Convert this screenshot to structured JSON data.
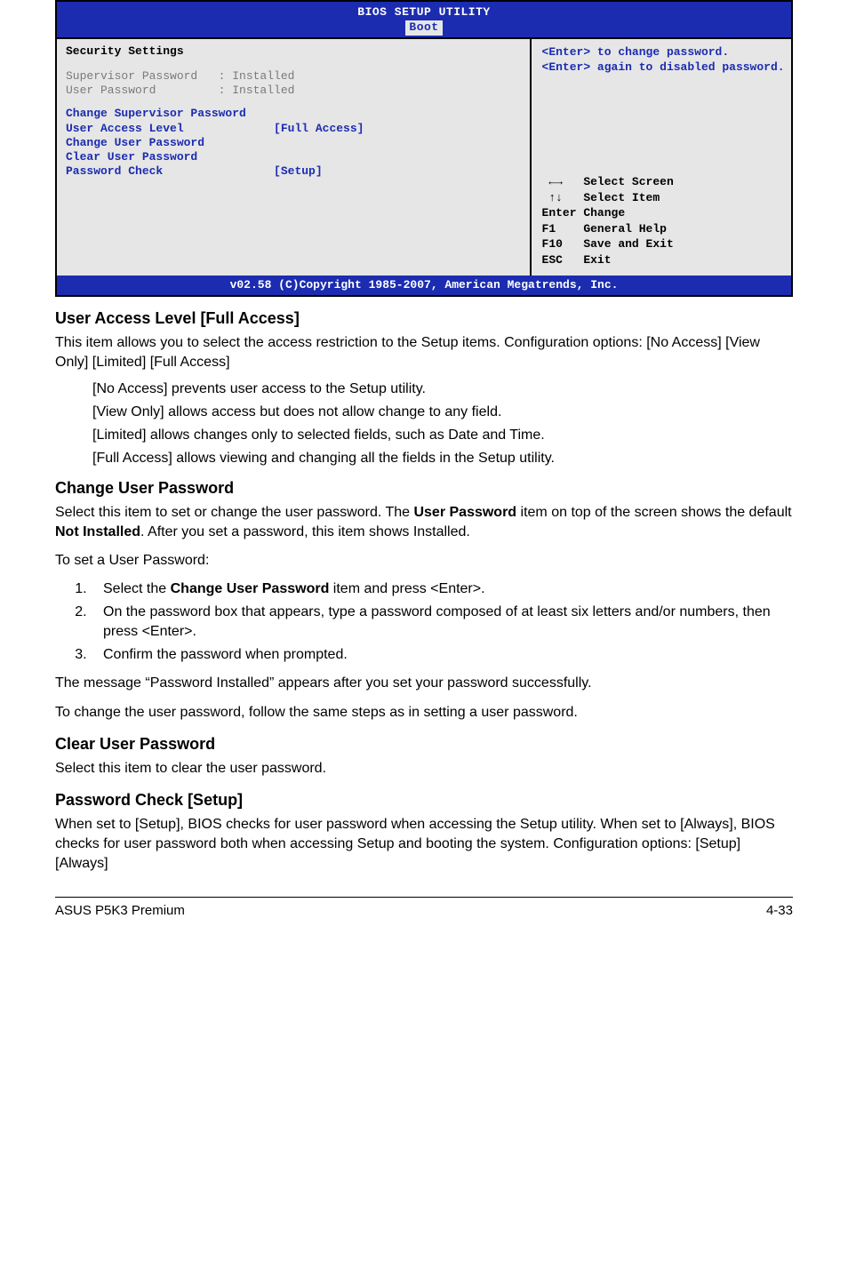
{
  "bios": {
    "title_line1": "BIOS SETUP UTILITY",
    "tab": "Boot",
    "left": {
      "heading": "Security Settings",
      "rows_gray": [
        "Supervisor Password   : Installed",
        "User Password         : Installed"
      ],
      "rows_blue": [
        "Change Supervisor Password",
        "User Access Level             [Full Access]",
        "Change User Password",
        "Clear User Password",
        "Password Check                [Setup]"
      ]
    },
    "right": {
      "help": "<Enter> to change password.\n<Enter> again to disabled password.",
      "nav": " ←→   Select Screen\n ↑↓   Select Item\nEnter Change\nF1    General Help\nF10   Save and Exit\nESC   Exit"
    },
    "footer": "v02.58 (C)Copyright 1985-2007, American Megatrends, Inc."
  },
  "doc": {
    "s1_h": "User Access Level [Full Access]",
    "s1_p1": "This item allows you to select the access restriction to the Setup items. Configuration options: [No Access] [View Only] [Limited] [Full Access]",
    "s1_li1": "[No Access] prevents user access to the Setup utility.",
    "s1_li2": "[View Only] allows access but does not allow change to any field.",
    "s1_li3": "[Limited] allows changes only to selected fields, such as Date and Time.",
    "s1_li4": "[Full Access] allows viewing and changing all the fields in the Setup utility.",
    "s2_h": "Change User Password",
    "s2_p1a": "Select this item to set or change the user password. The ",
    "s2_p1b_bold": "User Password",
    "s2_p1c": " item on top of the screen shows the default ",
    "s2_p1d_bold": "Not Installed",
    "s2_p1e": ". After you set a password, this item shows Installed.",
    "s2_p2": "To set a User Password:",
    "s2_step1a": "Select the ",
    "s2_step1b_bold": "Change User Password",
    "s2_step1c": " item and press <Enter>.",
    "s2_step2": "On the password box that appears, type a password composed of at least six letters and/or numbers, then press <Enter>.",
    "s2_step3": "Confirm the password when prompted.",
    "s2_p3": "The message “Password Installed” appears after you set your password successfully.",
    "s2_p4": "To change the user password, follow the same steps as in setting a user password.",
    "s3_h": "Clear User Password",
    "s3_p1": "Select this item to clear the user password.",
    "s4_h": "Password Check [Setup]",
    "s4_p1": "When set to [Setup], BIOS checks for user password when accessing the Setup utility. When set to [Always], BIOS checks for user password both when accessing Setup and booting the system. Configuration options: [Setup] [Always]",
    "footer_left": "ASUS P5K3 Premium",
    "footer_right": "4-33"
  }
}
